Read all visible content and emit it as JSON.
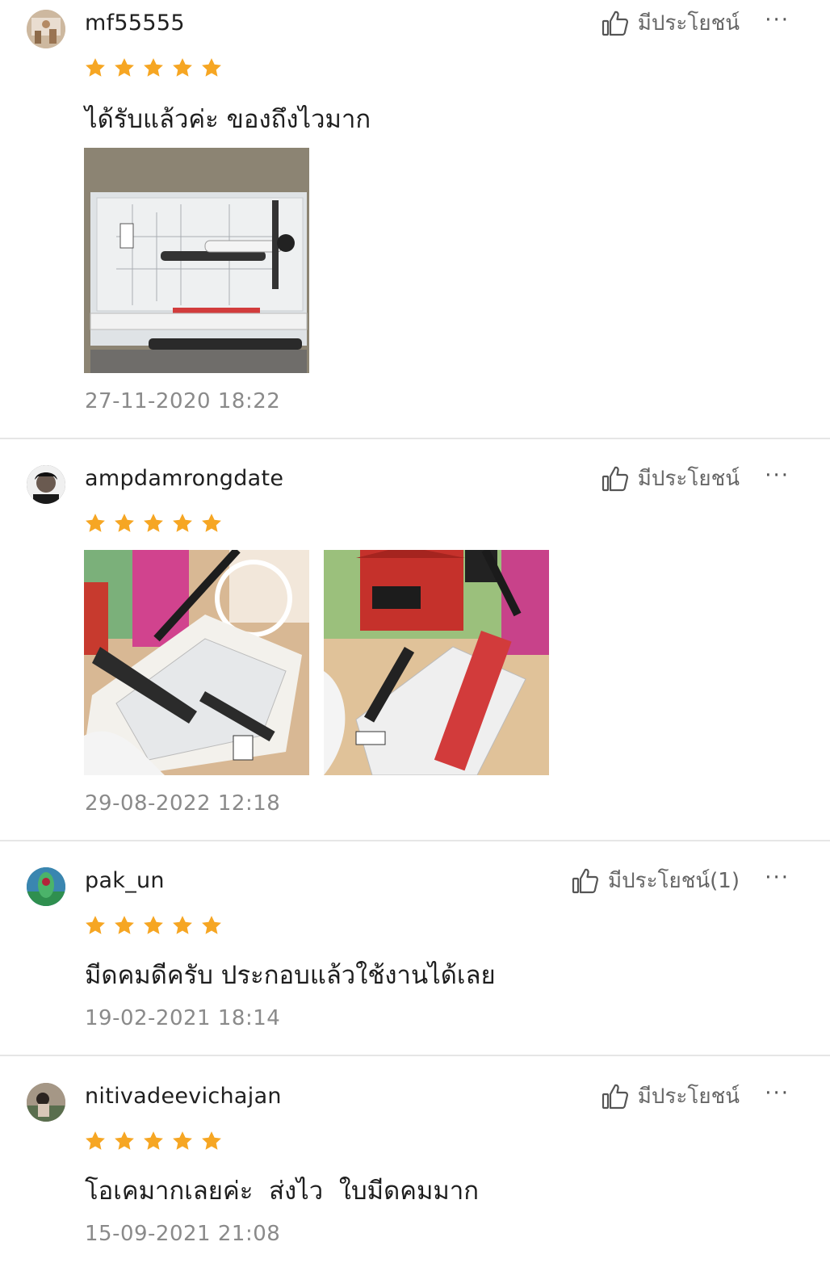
{
  "colors": {
    "star": "#f6a623",
    "divider": "#e6e6e6",
    "muted": "#8a8a8a"
  },
  "icons": {
    "helpful": "thumbs-up-icon",
    "more": "more-dots-icon",
    "star": "star-icon"
  },
  "reviews": [
    {
      "username": "mf55555",
      "helpful_label": "มีประโยชน์",
      "more_label": "···",
      "rating": 5,
      "comment": "ได้รับแล้วค่ะ ของถึงไวมาก",
      "timestamp": "27-11-2020 18:22"
    },
    {
      "username": "ampdamrongdate",
      "helpful_label": "มีประโยชน์",
      "more_label": "···",
      "rating": 5,
      "timestamp": "29-08-2022 12:18"
    },
    {
      "username": "pak_un",
      "helpful_label": "มีประโยชน์(1)",
      "more_label": "···",
      "rating": 5,
      "comment": "มีดคมดีครับ ประกอบแล้วใช้งานได้เลย",
      "timestamp": "19-02-2021 18:14"
    },
    {
      "username": "nitivadeevichajan",
      "helpful_label": "มีประโยชน์",
      "more_label": "···",
      "rating": 5,
      "comment": "โอเคมากเลยค่ะ  ส่งไว  ใบมีดคมมาก",
      "timestamp": "15-09-2021 21:08"
    }
  ]
}
